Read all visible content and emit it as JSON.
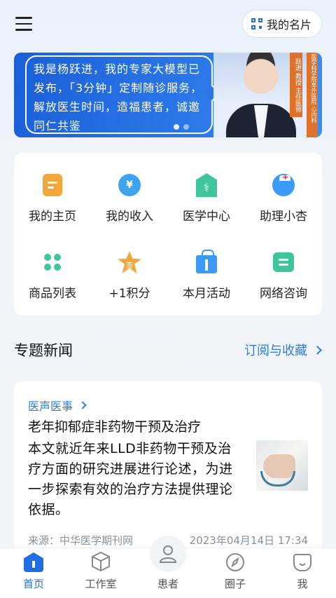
{
  "header": {
    "card_label": "我的名片"
  },
  "banner": {
    "text": "我是杨跃进，我的专家大模型已发布，「3分钟」定制随诊服务，解放医生时间，造福患者，诚邀同仁共鉴",
    "name_tag": "跃进 教授 主任医师",
    "side_tag": "医学科学院阜外医院 心内科"
  },
  "grid": {
    "items": [
      {
        "label": "我的主页"
      },
      {
        "label": "我的收入"
      },
      {
        "label": "医学中心"
      },
      {
        "label": "助理小杏"
      },
      {
        "label": "商品列表"
      },
      {
        "label": "+1积分"
      },
      {
        "label": "本月活动"
      },
      {
        "label": "网络咨询"
      }
    ],
    "income_icon_glyph": "¥",
    "med_icon_glyph": "⚕",
    "points_icon_glyph": "签"
  },
  "section": {
    "title": "专题新闻",
    "link": "订阅与收藏"
  },
  "news": {
    "category": "医声医事",
    "title": "老年抑郁症非药物干预及治疗",
    "summary": "本文就近年来LLD非药物干预及治疗方面的研究进展进行论述，为进一步探索有效的治疗方法提供理论依据。",
    "source": "来源：中华医学期刊网",
    "time": "2023年04月14日 17:34"
  },
  "nav": {
    "items": [
      {
        "label": "首页"
      },
      {
        "label": "工作室"
      },
      {
        "label": "患者"
      },
      {
        "label": "圈子"
      },
      {
        "label": "我"
      }
    ]
  },
  "colors": {
    "accent": "#2b7ee0",
    "active_nav": "#1f6fe0",
    "orange": "#f3a63a",
    "green": "#3ec59b"
  }
}
